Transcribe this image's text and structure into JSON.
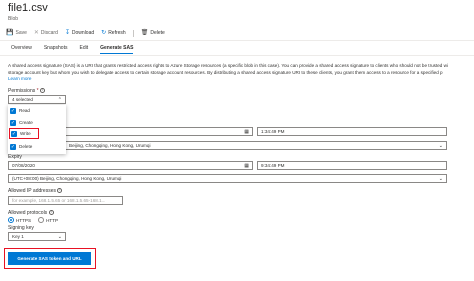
{
  "header": {
    "title": "file1.csv",
    "subtitle": "Blob"
  },
  "toolbar": {
    "save_label": "Save",
    "discard_label": "Discard",
    "download_label": "Download",
    "refresh_label": "Refresh",
    "delete_label": "Delete"
  },
  "tabs": [
    {
      "label": "Overview"
    },
    {
      "label": "Snapshots"
    },
    {
      "label": "Edit"
    },
    {
      "label": "Generate SAS"
    }
  ],
  "description": {
    "line1": "A shared access signature (SAS) is a URI that grants restricted access rights to Azure Storage resources (a specific blob in this case). You can provide a shared access signature to clients who should not be trusted wi",
    "line2": "storage account key but whom you wish to delegate access to certain storage account resources. By distributing a shared access signature URI to these clients, you grant them access to a resource for a specified p",
    "learn_more": "Learn more"
  },
  "permissions": {
    "label": "Permissions",
    "required_mark": "*",
    "selected_text": "4 selected",
    "options": [
      {
        "label": "Read",
        "checked": true
      },
      {
        "label": "Create",
        "checked": true
      },
      {
        "label": "Write",
        "checked": true
      },
      {
        "label": "Delete",
        "checked": true
      }
    ]
  },
  "start": {
    "time": "1:34:49 PM",
    "timezone": "Beijing, Chongqing, Hong Kong, Urumqi"
  },
  "expiry": {
    "label": "Expiry",
    "date": "07/08/2020",
    "time": "9:34:49 PM",
    "timezone": "(UTC+08:00) Beijing, Chongqing, Hong Kong, Urumqi"
  },
  "allowed_ips": {
    "label": "Allowed IP addresses",
    "placeholder": "for example, 168.1.5.65 or 168.1.5.65-168.1..."
  },
  "protocols": {
    "label": "Allowed protocols",
    "options": [
      {
        "label": "HTTPS",
        "selected": true
      },
      {
        "label": "HTTP",
        "selected": false
      }
    ]
  },
  "signing_key": {
    "label": "Signing key",
    "value": "Key 1"
  },
  "generate_button": {
    "label": "Generate SAS token and URL"
  },
  "colors": {
    "accent": "#0078d4",
    "highlight": "#e81123"
  }
}
